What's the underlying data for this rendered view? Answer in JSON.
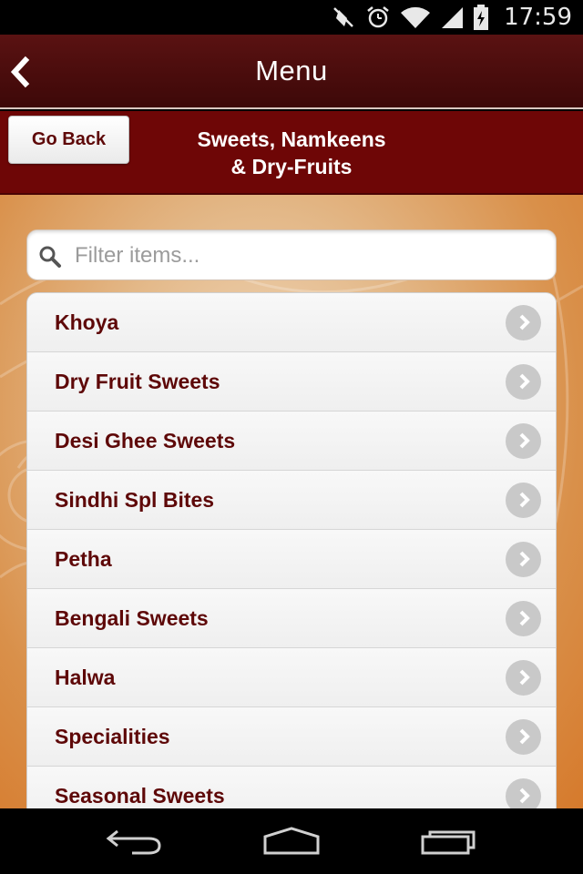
{
  "status_bar": {
    "time": "17:59",
    "icons": [
      "mute-icon",
      "alarm-icon",
      "wifi-icon",
      "signal-icon",
      "battery-icon"
    ]
  },
  "action_bar": {
    "title": "Menu",
    "back_icon": "chevron-left-icon"
  },
  "header": {
    "go_back_label": "Go Back",
    "title_line1": "Sweets, Namkeens",
    "title_line2": "& Dry-Fruits"
  },
  "search": {
    "placeholder": "Filter items...",
    "value": ""
  },
  "items": [
    {
      "label": "Khoya"
    },
    {
      "label": "Dry Fruit Sweets"
    },
    {
      "label": "Desi Ghee Sweets"
    },
    {
      "label": "Sindhi Spl Bites"
    },
    {
      "label": "Petha"
    },
    {
      "label": "Bengali Sweets"
    },
    {
      "label": "Halwa"
    },
    {
      "label": "Specialities"
    },
    {
      "label": "Seasonal Sweets"
    }
  ],
  "nav_bar": {
    "icons": [
      "back-nav-icon",
      "home-icon",
      "recent-apps-icon"
    ]
  },
  "colors": {
    "action_bar": "#4a0e0e",
    "header_band": "#6e0606",
    "item_text": "#5e0808",
    "accent_orange": "#d67a2c"
  }
}
